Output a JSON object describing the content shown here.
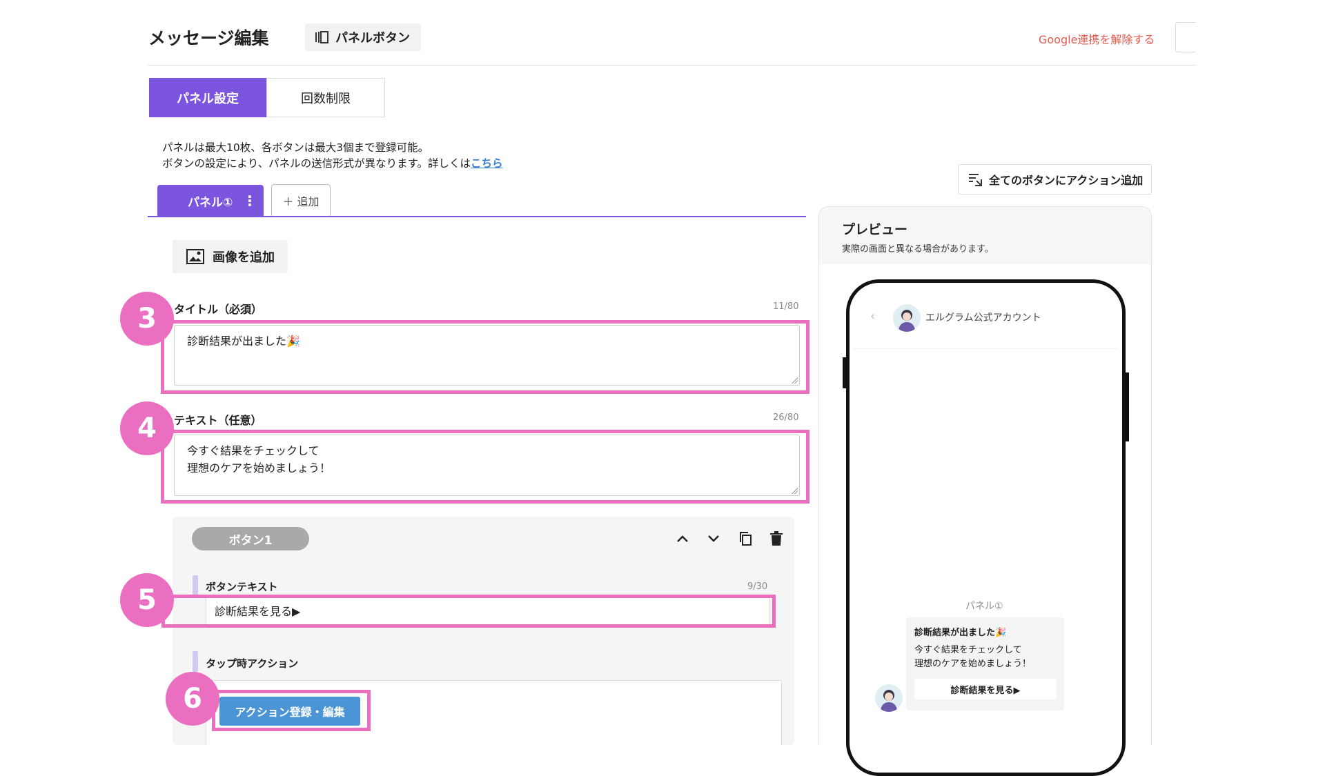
{
  "header": {
    "title": "メッセージ編集",
    "panel_button_label": "パネルボタン",
    "google_link": "Google連携を解除する"
  },
  "tabs": [
    {
      "label": "パネル設定",
      "active": true
    },
    {
      "label": "回数制限",
      "active": false
    }
  ],
  "info": {
    "line1": "パネルは最大10枚、各ボタンは最大3個まで登録可能。",
    "line2_prefix": "ボタンの設定により、パネルの送信形式が異なります。詳しくは",
    "line2_link": "こちら"
  },
  "all_buttons_action_label": "全てのボタンにアクション追加",
  "panel_tabs": {
    "active_label": "パネル①",
    "add_label": "＋ 追加"
  },
  "add_image_label": "画像を追加",
  "title_field": {
    "label": "タイトル（必須）",
    "counter": "11/80",
    "value": "診断結果が出ました🎉",
    "badge": "3"
  },
  "text_field": {
    "label": "テキスト（任意）",
    "counter": "26/80",
    "line1": "今すぐ結果をチェックして",
    "line2": "理想のケアを始めましょう！",
    "badge": "4"
  },
  "button_card": {
    "pill_label": "ボタン1",
    "button_text_label": "ボタンテキスト",
    "button_text_counter": "9/30",
    "button_text_value": "診断結果を見る▶",
    "button_text_badge": "5",
    "tap_action_label": "タップ時アクション",
    "action_button_label": "アクション登録・編集",
    "action_badge": "6"
  },
  "preview": {
    "title": "プレビュー",
    "subtitle": "実際の画面と異なる場合があります。",
    "account_name": "エルグラム公式アカウント",
    "panel_label": "パネル①",
    "bubble_title": "診断結果が出ました🎉",
    "bubble_text": "今すぐ結果をチェックして\n理想のケアを始めましょう！",
    "bubble_button": "診断結果を見る▶"
  },
  "colors": {
    "accent_purple": "#7b55dd",
    "highlight_pink": "#ea6fc1",
    "action_blue": "#4b95d6",
    "link_red": "#e25b4c"
  },
  "icons": [
    "panel-icon",
    "filter-add-icon",
    "kebab-icon",
    "image-icon",
    "chevron-up-icon",
    "chevron-down-icon",
    "copy-icon",
    "trash-icon",
    "back-chevron-icon",
    "avatar"
  ]
}
